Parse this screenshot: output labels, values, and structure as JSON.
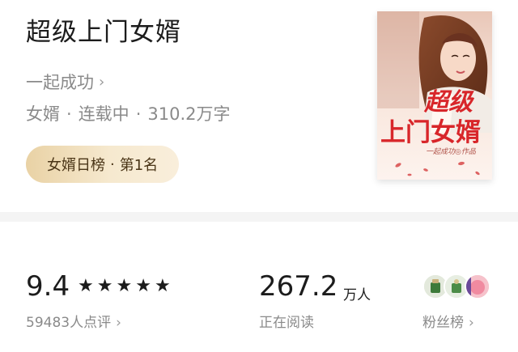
{
  "book": {
    "title": "超级上门女婿",
    "author": "一起成功",
    "author_chevron": "›",
    "category": "女婿",
    "status": "连载中",
    "word_count": "310.2万字",
    "separator": "·",
    "rank_list": "女婿日榜",
    "rank_position": "第1名"
  },
  "cover": {
    "title_line1": "超级",
    "title_line2": "上门女婿",
    "byline": "一起成功◎作品"
  },
  "stats": {
    "score": "9.4",
    "stars_filled": 5,
    "stars_total": 5,
    "star_glyph": "★",
    "reviews": "59483人点评",
    "readers_value": "267.2",
    "readers_unit": "万人",
    "readers_label": "正在阅读",
    "fans_label": "粉丝榜",
    "chevron": "›"
  },
  "colors": {
    "badge_gradient_start": "#e9d2a5",
    "badge_gradient_end": "#f9eedb",
    "cover_title_red": "#d8262a",
    "divider": "#f4f4f4",
    "muted_text": "#8a8a8a"
  }
}
